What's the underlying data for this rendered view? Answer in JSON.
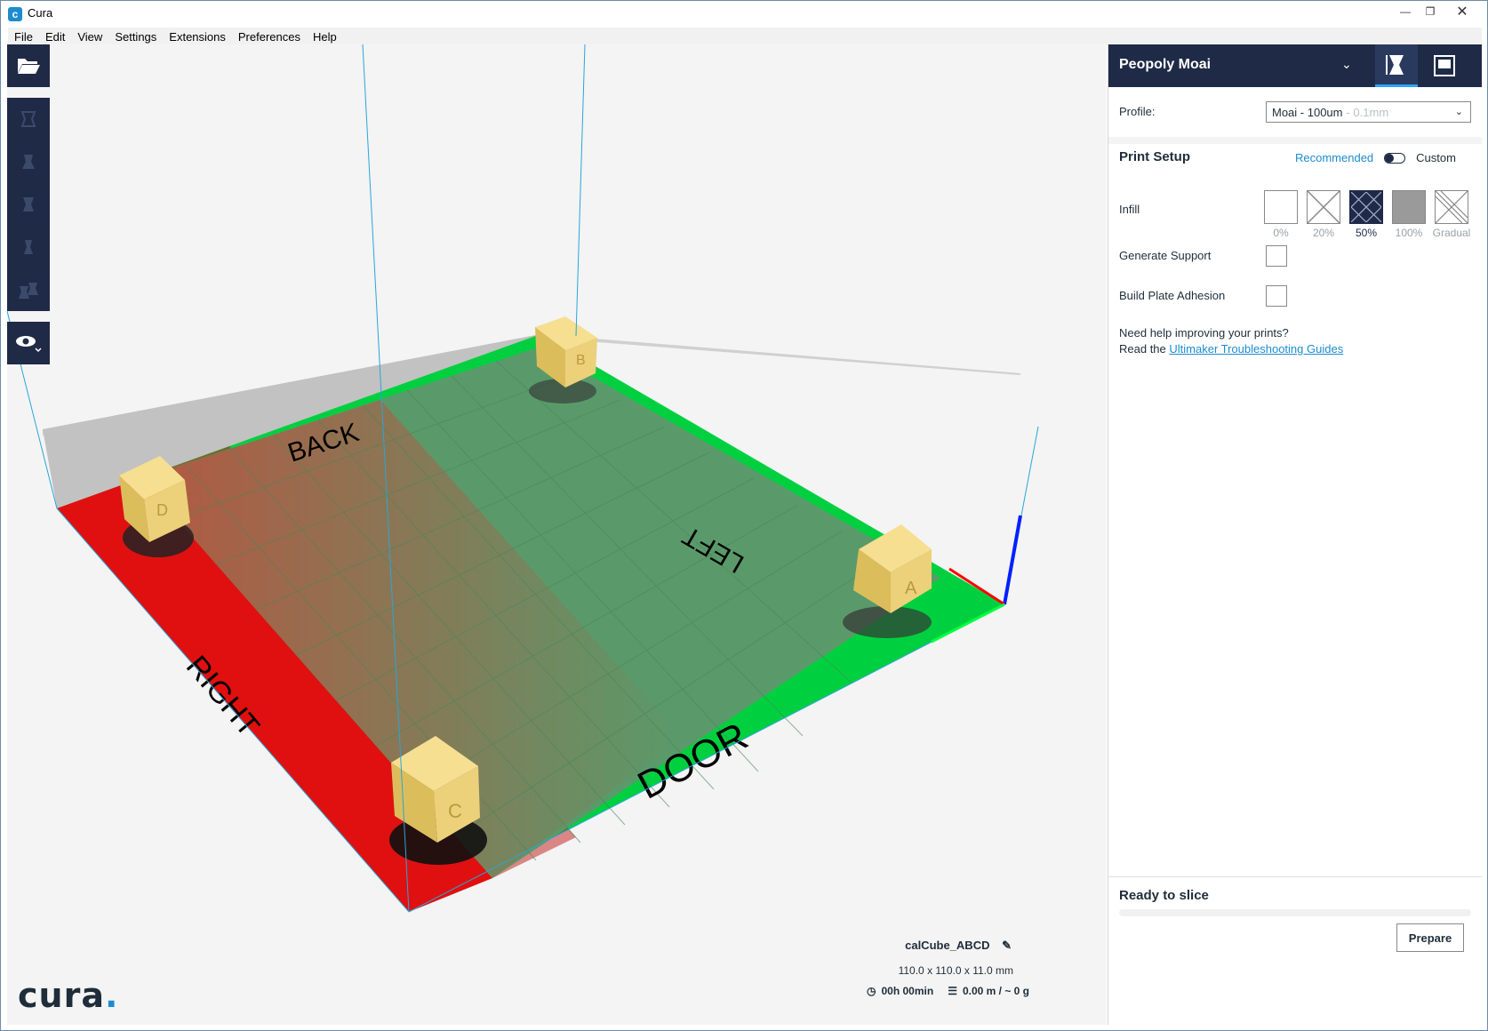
{
  "window": {
    "title": "Cura",
    "min_icon": "minimize-icon",
    "max_icon": "maximize-icon",
    "close_icon": "close-icon"
  },
  "menu": [
    "File",
    "Edit",
    "View",
    "Settings",
    "Extensions",
    "Preferences",
    "Help"
  ],
  "viewport": {
    "plate_labels": {
      "back": "BACK",
      "left": "LEFT",
      "right": "RIGHT",
      "door": "DOOR"
    },
    "cube_faces": [
      "D",
      "B",
      "A",
      "C"
    ]
  },
  "object": {
    "name": "calCube_ABCD",
    "dimensions": "110.0 x 110.0 x 11.0 mm",
    "print_time": "00h 00min",
    "material": "0.00 m / ~ 0 g"
  },
  "logo": {
    "text": "cura",
    "dot": "."
  },
  "sidebar": {
    "machine": "Peopoly Moai",
    "profile_label": "Profile:",
    "profile_value": "Moai - 100um",
    "profile_sub": "- 0.1mm",
    "print_setup": "Print Setup",
    "recommended": "Recommended",
    "custom": "Custom",
    "infill_label": "Infill",
    "infill_options": [
      "0%",
      "20%",
      "50%",
      "100%",
      "Gradual"
    ],
    "infill_selected": "50%",
    "generate_support": "Generate Support",
    "build_plate_adhesion": "Build Plate Adhesion",
    "help_line1": "Need help improving your prints?",
    "help_prefix": "Read the ",
    "help_link": "Ultimaker Troubleshooting Guides",
    "slice_status": "Ready to slice",
    "prepare_button": "Prepare"
  },
  "colors": {
    "dark_navy": "#1f2a47",
    "accent_blue": "#1c8ccf",
    "plate_green": "#00e84a",
    "plate_red": "#ff1a1a",
    "cube_yellow": "#efd27a"
  }
}
